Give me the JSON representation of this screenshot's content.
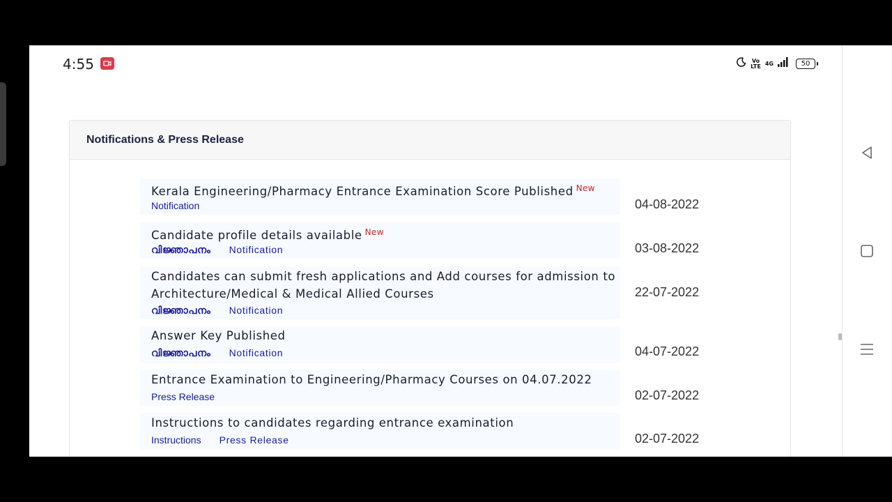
{
  "status_bar": {
    "time": "4:55",
    "volte_top": "Vo",
    "volte_bottom": "LTE",
    "network": "4G",
    "battery": "50"
  },
  "panel": {
    "title": "Notifications & Press Release"
  },
  "items": [
    {
      "title": "Kerala Engineering/Pharmacy Entrance Examination Score Published",
      "new": "New",
      "links": [
        "Notification"
      ],
      "date": "04-08-2022"
    },
    {
      "title": "Candidate profile details available",
      "new": "New",
      "links": [
        "വിജ്ഞാപനം",
        "Notification"
      ],
      "date": "03-08-2022"
    },
    {
      "title_line1": "Candidates can submit fresh applications and Add courses for admission to",
      "title_line2": "Architecture/Medical & Medical Allied Courses",
      "links": [
        "വിജ്ഞാപനം",
        "Notification"
      ],
      "date": "22-07-2022"
    },
    {
      "title": "Answer Key Published",
      "links": [
        "വിജ്ഞാപനം",
        "Notification"
      ],
      "date": "04-07-2022"
    },
    {
      "title": "Entrance Examination to Engineering/Pharmacy Courses on 04.07.2022",
      "links": [
        "Press Release"
      ],
      "date": "02-07-2022"
    },
    {
      "title": "Instructions to candidates regarding entrance examination",
      "links": [
        "Instructions",
        "Press Release"
      ],
      "date": "02-07-2022"
    }
  ],
  "colors": {
    "link": "#1a1a9c",
    "new_tag": "#c62828",
    "title": "#1c2340",
    "record_badge": "#e03a4a"
  },
  "icons": [
    "record-icon",
    "moon-icon",
    "signal-icon",
    "back-icon",
    "home-icon",
    "recents-icon"
  ]
}
